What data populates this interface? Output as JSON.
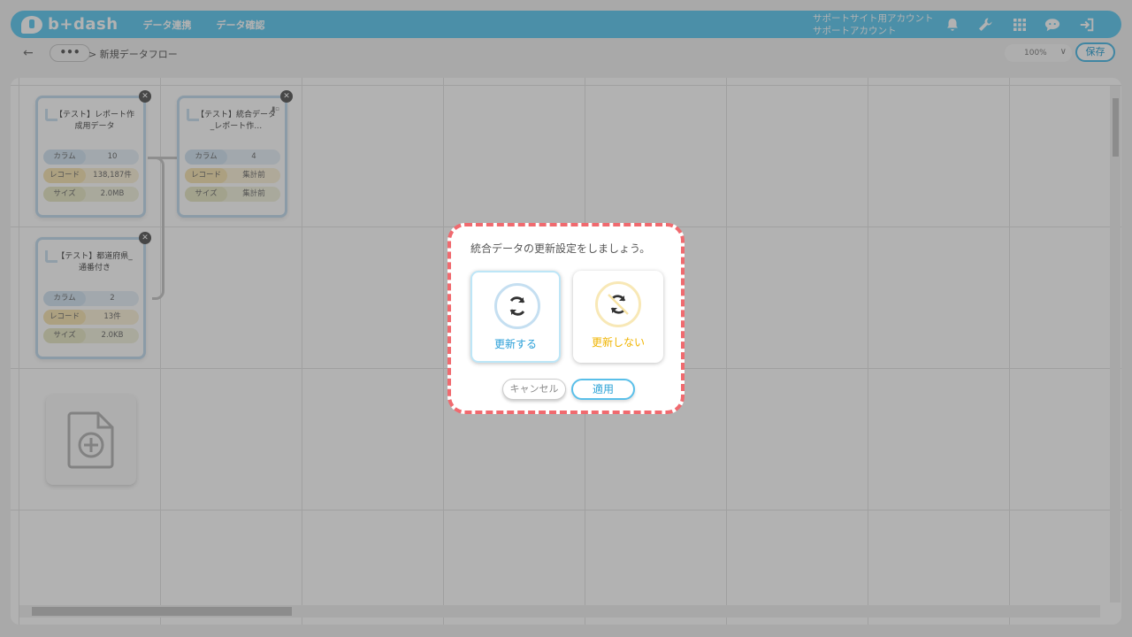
{
  "header": {
    "logo": "b+dash",
    "nav": [
      "データ連携",
      "データ確認"
    ],
    "account_line1": "サポートサイト用アカウント",
    "account_line2": "サポートアカウント",
    "icons": [
      "bell-icon",
      "wrench-icon",
      "grid-icon",
      "chat-icon",
      "logout-icon"
    ]
  },
  "toolbar": {
    "more": "•••",
    "breadcrumb": "> 新規データフロー",
    "zoom": "100%",
    "save": "保存"
  },
  "nodes": [
    {
      "title": "【テスト】レポート作成用データ",
      "col_label": "カラム",
      "col": "10",
      "rec_label": "レコード",
      "rec": "138,187件",
      "size_label": "サイズ",
      "size": "2.0MB"
    },
    {
      "title": "【テスト】統合データ_レポート作…",
      "col_label": "カラム",
      "col": "4",
      "rec_label": "レコード",
      "rec": "集計前",
      "size_label": "サイズ",
      "size": "集計前"
    },
    {
      "title": "【テスト】都道府県_通番付き",
      "col_label": "カラム",
      "col": "2",
      "rec_label": "レコード",
      "rec": "13件",
      "size_label": "サイズ",
      "size": "2.0KB"
    }
  ],
  "modal": {
    "message": "統合データの更新設定をしましょう。",
    "option_update": "更新する",
    "option_no_update": "更新しない",
    "cancel": "キャンセル",
    "apply": "適用",
    "accent_blue": "#2a9fd8",
    "accent_yellow": "#f0b400",
    "border_color": "#f06a6f"
  }
}
